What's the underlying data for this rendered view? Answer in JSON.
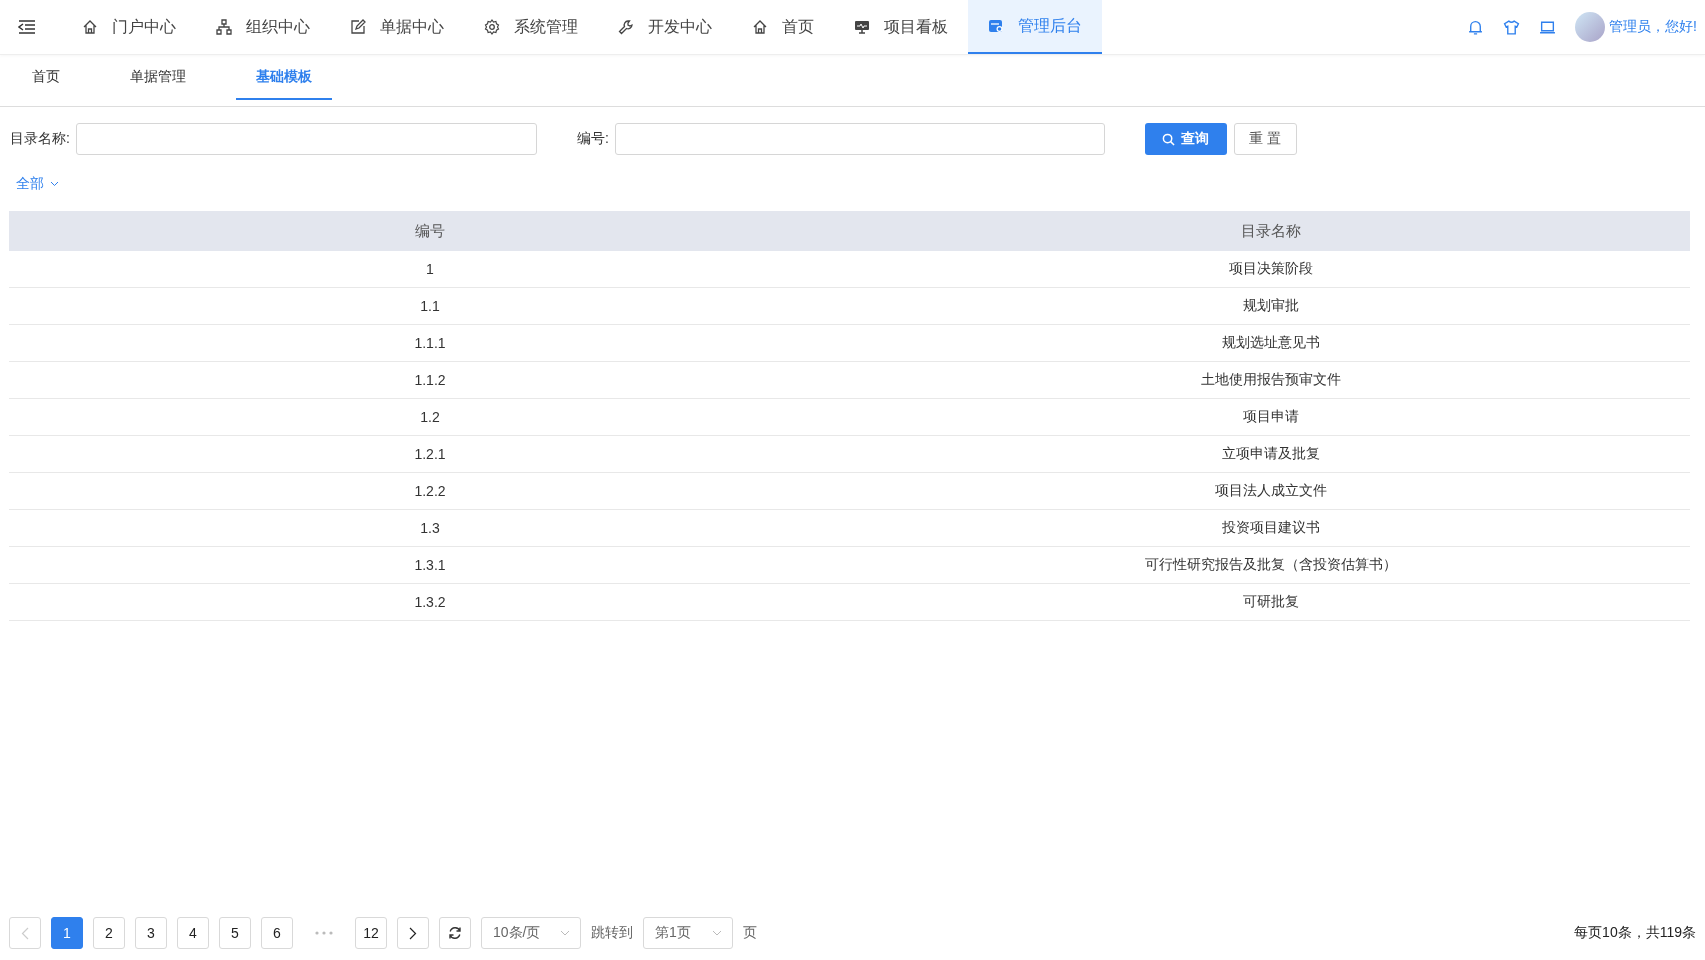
{
  "nav": [
    {
      "label": "门户中心",
      "kind": "home",
      "selected": false
    },
    {
      "label": "组织中心",
      "kind": "org",
      "selected": false
    },
    {
      "label": "单据中心",
      "kind": "edit",
      "selected": false
    },
    {
      "label": "系统管理",
      "kind": "gear",
      "selected": false
    },
    {
      "label": "开发中心",
      "kind": "wrench",
      "selected": false
    },
    {
      "label": "首页",
      "kind": "home",
      "selected": false
    },
    {
      "label": "项目看板",
      "kind": "monitor",
      "selected": false
    },
    {
      "label": "管理后台",
      "kind": "panel",
      "selected": true
    }
  ],
  "user": {
    "greeting": "管理员，您好!"
  },
  "tabs": [
    {
      "label": "首页",
      "selected": false
    },
    {
      "label": "单据管理",
      "selected": false
    },
    {
      "label": "基础模板",
      "selected": true
    }
  ],
  "search": {
    "fields": [
      {
        "label": "目录名称:"
      },
      {
        "label": "编号:"
      }
    ],
    "query_button": "查询",
    "reset_button": "重 置"
  },
  "filter": {
    "label": "全部"
  },
  "table": {
    "columns": [
      "编号",
      "目录名称"
    ],
    "rows": [
      [
        "1",
        "项目决策阶段"
      ],
      [
        "1.1",
        "规划审批"
      ],
      [
        "1.1.1",
        "规划选址意见书"
      ],
      [
        "1.1.2",
        "土地使用报告预审文件"
      ],
      [
        "1.2",
        "项目申请"
      ],
      [
        "1.2.1",
        "立项申请及批复"
      ],
      [
        "1.2.2",
        "项目法人成立文件"
      ],
      [
        "1.3",
        "投资项目建议书"
      ],
      [
        "1.3.1",
        "可行性研究报告及批复（含投资估算书）"
      ],
      [
        "1.3.2",
        "可研批复"
      ]
    ]
  },
  "pagination": {
    "items": [
      {
        "kind": "prev",
        "disabled": true
      },
      {
        "kind": "page",
        "label": "1",
        "selected": true
      },
      {
        "kind": "page",
        "label": "2",
        "selected": false
      },
      {
        "kind": "page",
        "label": "3",
        "selected": false
      },
      {
        "kind": "page",
        "label": "4",
        "selected": false
      },
      {
        "kind": "page",
        "label": "5",
        "selected": false
      },
      {
        "kind": "page",
        "label": "6",
        "selected": false
      },
      {
        "kind": "ellipsis"
      },
      {
        "kind": "page",
        "label": "12",
        "selected": false
      },
      {
        "kind": "next",
        "disabled": false
      },
      {
        "kind": "refresh"
      }
    ],
    "page_size": "10条/页",
    "jump_label": "跳转到",
    "jump_value": "第1页",
    "jump_suffix": "页",
    "summary": "每页10条，共119条"
  }
}
